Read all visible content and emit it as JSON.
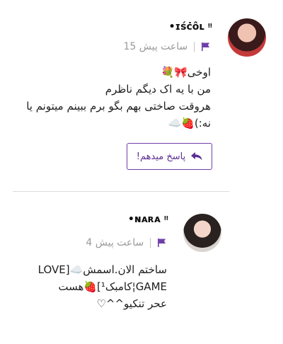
{
  "colors": {
    "accent": "#6f3ea8",
    "meta_text": "#9a9a9a",
    "divider": "#dcdcdc"
  },
  "comments": [
    {
      "username": "•ɪśċôʟ ᵎᵎ",
      "time_ago": "15 ساعت پیش",
      "separator": "|",
      "flag_icon": "flag-icon",
      "body_lines": "اوخی🎀💐\nمن با یه اک دیگم ناظرم\nهروقت صاختی بهم بگو برم ببینم میتونم یا نه:)🍓☁️",
      "reply_label": "پاسخ میدهم!",
      "reply_icon": "reply-arrow-icon"
    },
    {
      "username": "•ɴᴀʀᴀ ᵎᵎ",
      "time_ago": "4 ساعت پیش",
      "separator": "|",
      "flag_icon": "flag-icon",
      "body_lines": "ساختم الان.اسمش☁️[LOVE\nGAME¦کامبک¹]🍓هست\nعحر تنکیو^^♡"
    }
  ]
}
